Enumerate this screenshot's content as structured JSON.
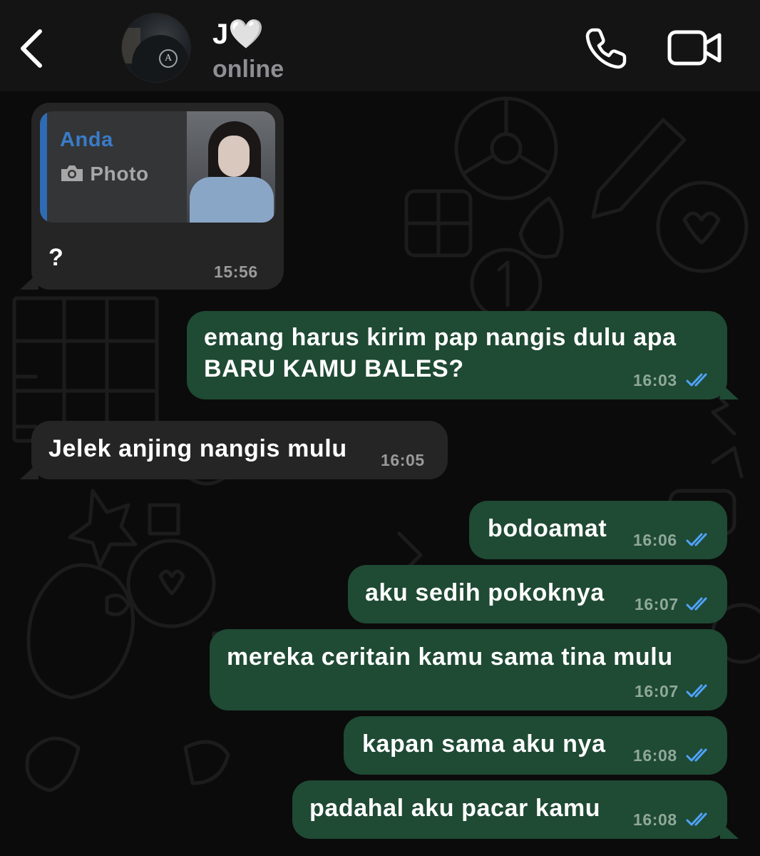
{
  "header": {
    "contact_name": "J",
    "contact_heart": "🤍",
    "contact_status": "online",
    "icons": [
      "chevron-left-icon",
      "phone-icon",
      "video-camera-icon"
    ]
  },
  "colors": {
    "incoming_bubble": "#252525",
    "outgoing_bubble": "#1f4a34",
    "read_ticks": "#4fa3ff",
    "quote_accent": "#2e6bb3"
  },
  "messages": [
    {
      "direction": "incoming",
      "reply_to": {
        "author": "Anda",
        "type": "Photo"
      },
      "text": "?",
      "time": "15:56"
    },
    {
      "direction": "outgoing",
      "lines": [
        "emang harus kirim pap nangis dulu apa",
        "BARU KAMU BALES?"
      ],
      "time": "16:03",
      "status": "read"
    },
    {
      "direction": "incoming",
      "text": "Jelek anjing nangis mulu",
      "time": "16:05"
    },
    {
      "direction": "outgoing",
      "text": "bodoamat",
      "time": "16:06",
      "status": "read"
    },
    {
      "direction": "outgoing",
      "text": "aku sedih pokoknya",
      "time": "16:07",
      "status": "read"
    },
    {
      "direction": "outgoing",
      "text": "mereka ceritain kamu sama tina mulu",
      "time": "16:07",
      "status": "read"
    },
    {
      "direction": "outgoing",
      "text": "kapan sama aku nya",
      "time": "16:08",
      "status": "read"
    },
    {
      "direction": "outgoing",
      "text": "padahal aku pacar kamu",
      "time": "16:08",
      "status": "read"
    }
  ]
}
